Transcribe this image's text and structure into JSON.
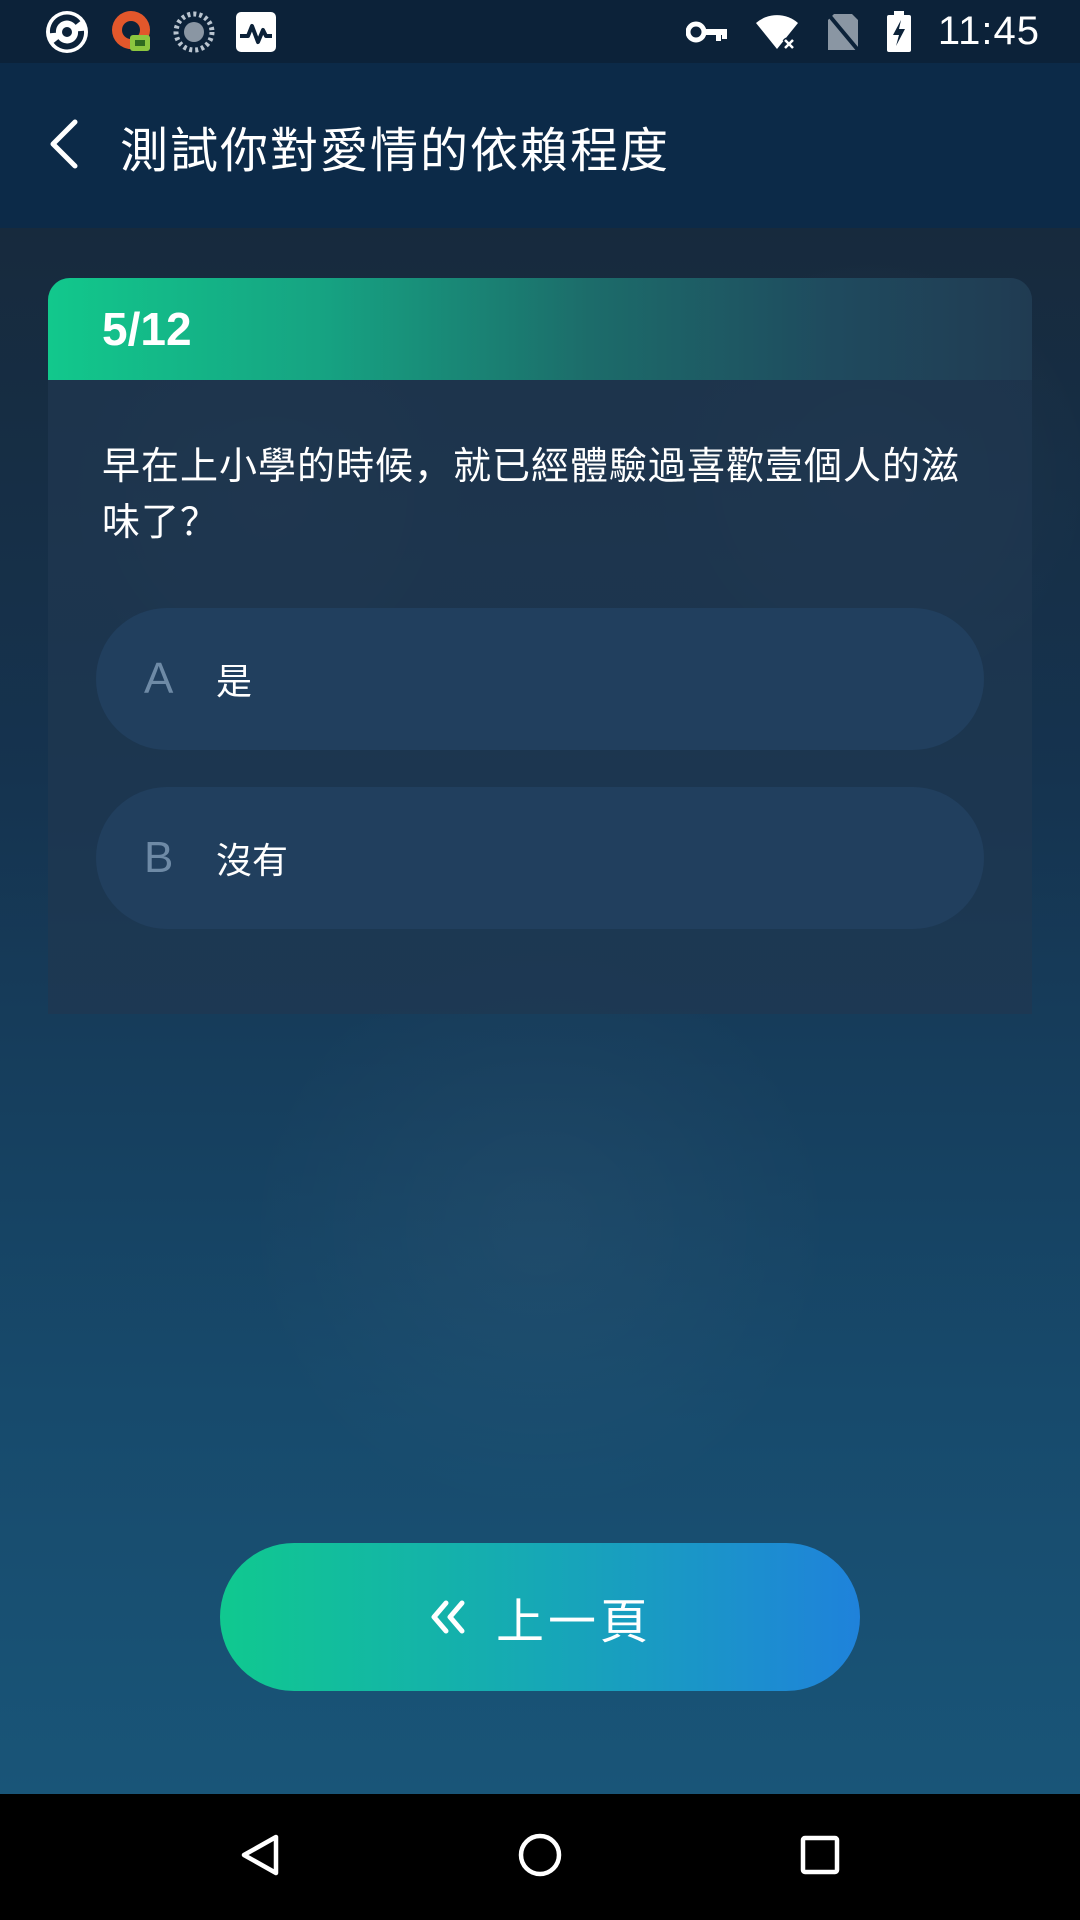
{
  "status_bar": {
    "time": "11:45",
    "icons": [
      "app-logo-icon",
      "vpn-app-icon",
      "loading-icon",
      "activity-icon",
      "key-icon",
      "wifi-icon",
      "no-sim-icon",
      "battery-charging-icon"
    ]
  },
  "app_bar": {
    "title": "測試你對愛情的依賴程度",
    "back_icon": "chevron-left-icon"
  },
  "quiz": {
    "progress": "5/12",
    "question": "早在上小學的時候，就已經體驗過喜歡壹個人的滋味了？",
    "options": [
      {
        "letter": "A",
        "text": "是"
      },
      {
        "letter": "B",
        "text": "沒有"
      }
    ]
  },
  "prev_button": {
    "label": "上一頁",
    "icon": "double-chevron-left-icon"
  },
  "nav_bar": {
    "icons": [
      "nav-back-icon",
      "nav-home-icon",
      "nav-recents-icon"
    ]
  },
  "colors": {
    "accent_green": "#12c88c",
    "accent_blue": "#1f82db",
    "option_bg": "#213f5e",
    "app_bar_bg": "#0c2a48"
  }
}
